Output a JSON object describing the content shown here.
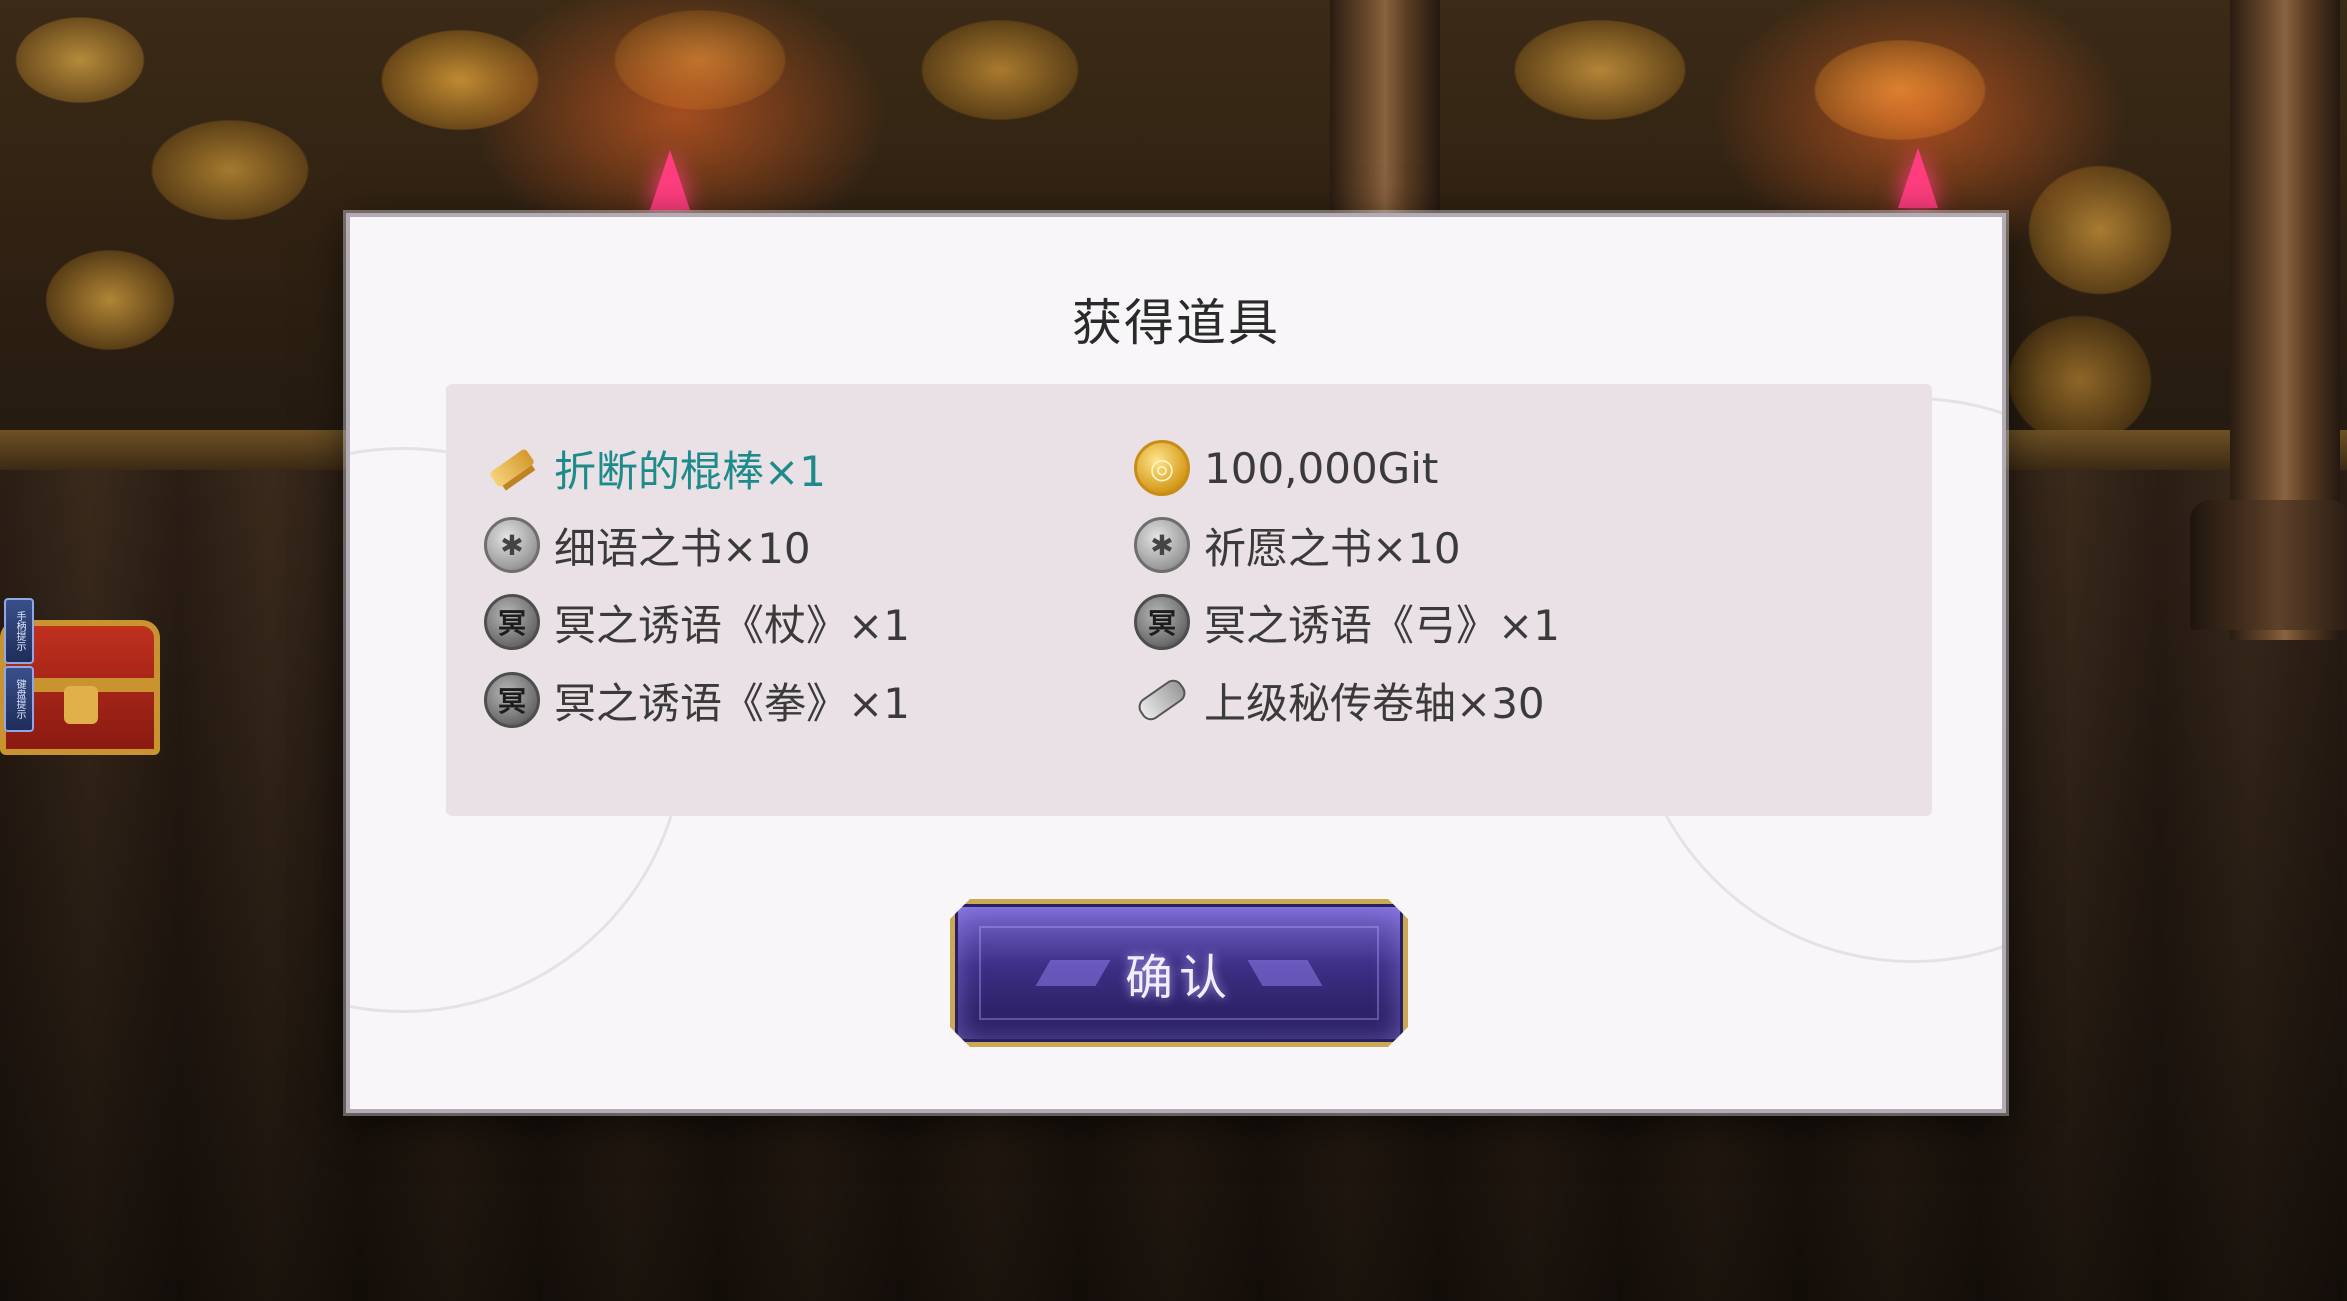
{
  "dialog": {
    "title": "获得道具",
    "confirm_label": "确认",
    "items": [
      {
        "name": "折断的棍棒×1",
        "icon": "broken-club-icon",
        "highlight": true
      },
      {
        "name": "100,000Git",
        "icon": "gold-coin-icon",
        "highlight": false
      },
      {
        "name": "细语之书×10",
        "icon": "whisper-book-icon",
        "highlight": false
      },
      {
        "name": "祈愿之书×10",
        "icon": "wish-book-icon",
        "highlight": false
      },
      {
        "name": "冥之诱语《杖》×1",
        "icon": "dark-rune-icon",
        "highlight": false
      },
      {
        "name": "冥之诱语《弓》×1",
        "icon": "dark-rune-icon",
        "highlight": false
      },
      {
        "name": "冥之诱语《拳》×1",
        "icon": "dark-rune-icon",
        "highlight": false
      },
      {
        "name": "上级秘传卷轴×30",
        "icon": "scroll-icon",
        "highlight": false
      }
    ]
  },
  "side_tabs": [
    "手柄提示",
    "键盘提示"
  ],
  "colors": {
    "highlight_text": "#1e8b8b",
    "button_border": "#c9a955",
    "button_fill": "#3d2f86"
  }
}
